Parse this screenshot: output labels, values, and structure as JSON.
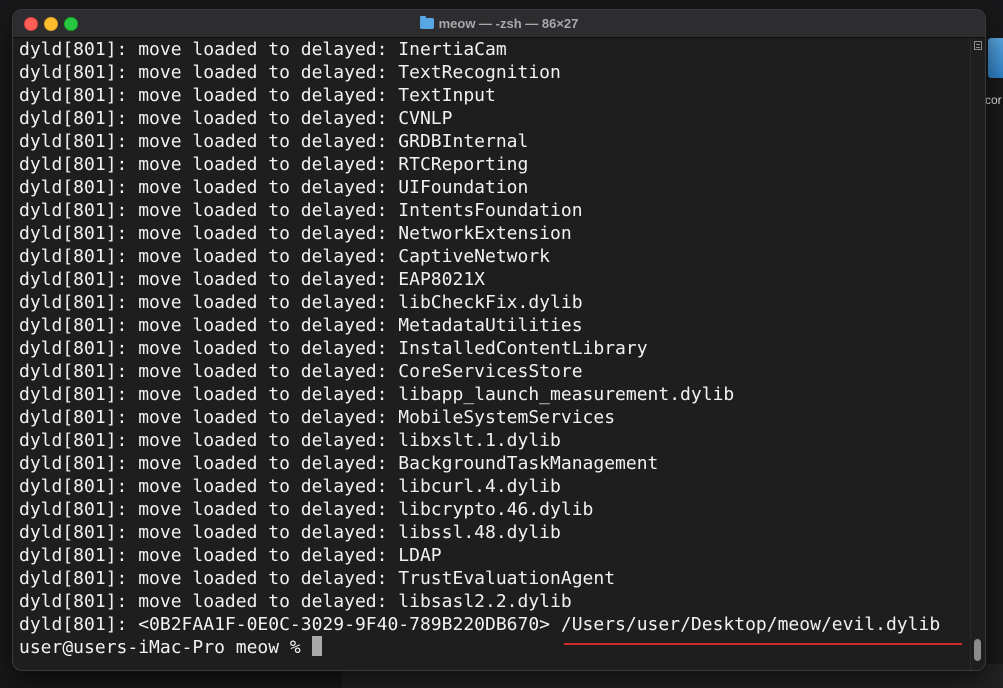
{
  "window": {
    "title": "meow — -zsh — 86×27"
  },
  "desktop": {
    "label": "cor"
  },
  "terminal": {
    "prefix": "dyld[801]: move loaded to delayed: ",
    "lines": [
      "InertiaCam",
      "TextRecognition",
      "TextInput",
      "CVNLP",
      "GRDBInternal",
      "RTCReporting",
      "UIFoundation",
      "IntentsFoundation",
      "NetworkExtension",
      "CaptiveNetwork",
      "EAP8021X",
      "libCheckFix.dylib",
      "MetadataUtilities",
      "InstalledContentLibrary",
      "CoreServicesStore",
      "libapp_launch_measurement.dylib",
      "MobileSystemServices",
      "libxslt.1.dylib",
      "BackgroundTaskManagement",
      "libcurl.4.dylib",
      "libcrypto.46.dylib",
      "libssl.48.dylib",
      "LDAP",
      "TrustEvaluationAgent",
      "libsasl2.2.dylib"
    ],
    "uuid_line_prefix": "dyld[801]: <0B2FAA1F-0E0C-3029-9F40-789B220DB670> ",
    "uuid_line_path": "/Users/user/Desktop/meow/evil.dylib",
    "prompt": "user@users-iMac-Pro meow % "
  },
  "colors": {
    "background": "#1e1e1e",
    "text": "#f2f2f2",
    "underline": "#d12a2a"
  }
}
